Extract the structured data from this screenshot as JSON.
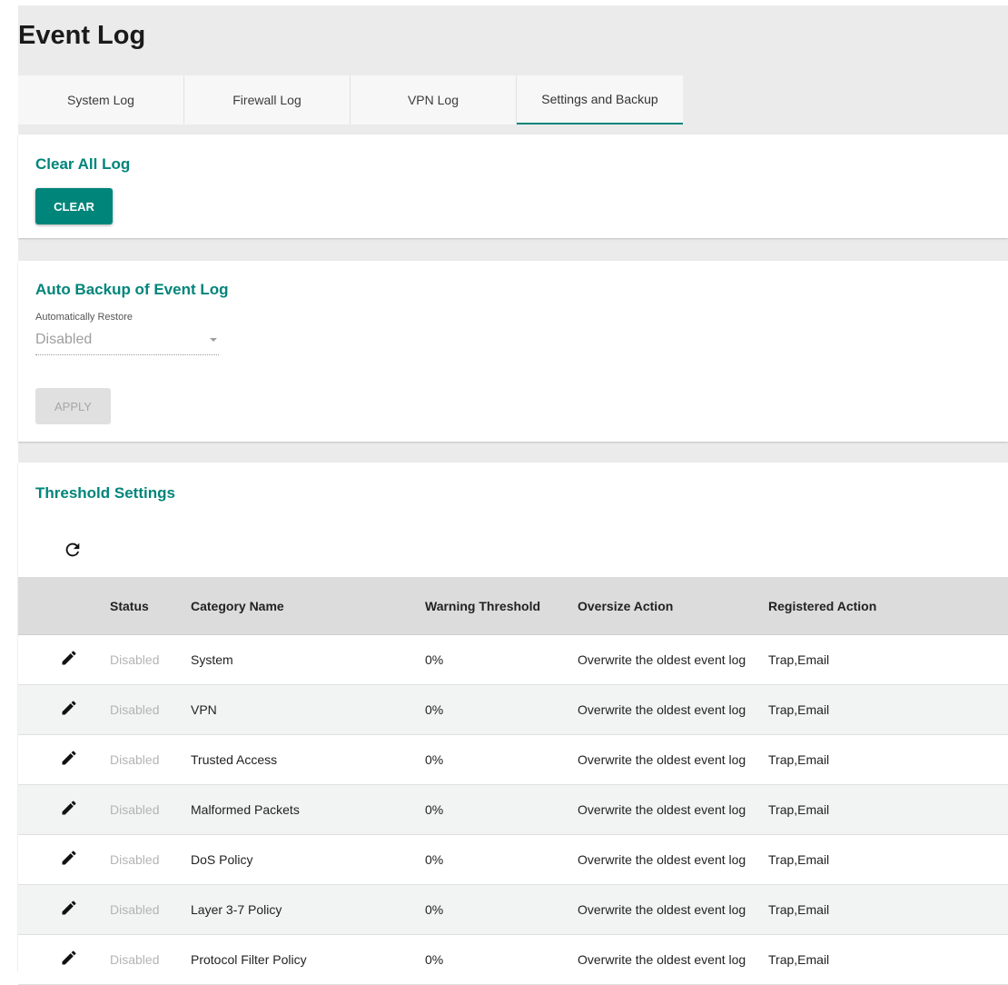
{
  "page": {
    "title": "Event Log"
  },
  "tabs": [
    {
      "label": "System Log"
    },
    {
      "label": "Firewall Log"
    },
    {
      "label": "VPN Log"
    },
    {
      "label": "Settings and Backup",
      "active": true
    }
  ],
  "clear_card": {
    "title": "Clear All Log",
    "button_label": "CLEAR"
  },
  "backup_card": {
    "title": "Auto Backup of Event Log",
    "restore_label": "Automatically Restore",
    "restore_value": "Disabled",
    "apply_label": "APPLY"
  },
  "threshold_card": {
    "title": "Threshold Settings",
    "columns": [
      "Status",
      "Category Name",
      "Warning Threshold",
      "Oversize Action",
      "Registered Action"
    ],
    "rows": [
      {
        "status": "Disabled",
        "category": "System",
        "threshold": "0%",
        "oversize": "Overwrite the oldest event log",
        "registered": "Trap,Email"
      },
      {
        "status": "Disabled",
        "category": "VPN",
        "threshold": "0%",
        "oversize": "Overwrite the oldest event log",
        "registered": "Trap,Email"
      },
      {
        "status": "Disabled",
        "category": "Trusted Access",
        "threshold": "0%",
        "oversize": "Overwrite the oldest event log",
        "registered": "Trap,Email"
      },
      {
        "status": "Disabled",
        "category": "Malformed Packets",
        "threshold": "0%",
        "oversize": "Overwrite the oldest event log",
        "registered": "Trap,Email"
      },
      {
        "status": "Disabled",
        "category": "DoS Policy",
        "threshold": "0%",
        "oversize": "Overwrite the oldest event log",
        "registered": "Trap,Email"
      },
      {
        "status": "Disabled",
        "category": "Layer 3-7 Policy",
        "threshold": "0%",
        "oversize": "Overwrite the oldest event log",
        "registered": "Trap,Email"
      },
      {
        "status": "Disabled",
        "category": "Protocol Filter Policy",
        "threshold": "0%",
        "oversize": "Overwrite the oldest event log",
        "registered": "Trap,Email"
      }
    ]
  },
  "colors": {
    "accent": "#00857a",
    "disabled_text": "#b4b4b4",
    "page_bg": "#ebebeb"
  },
  "icons": {
    "refresh": "refresh-icon",
    "edit": "edit-pencil-icon"
  }
}
